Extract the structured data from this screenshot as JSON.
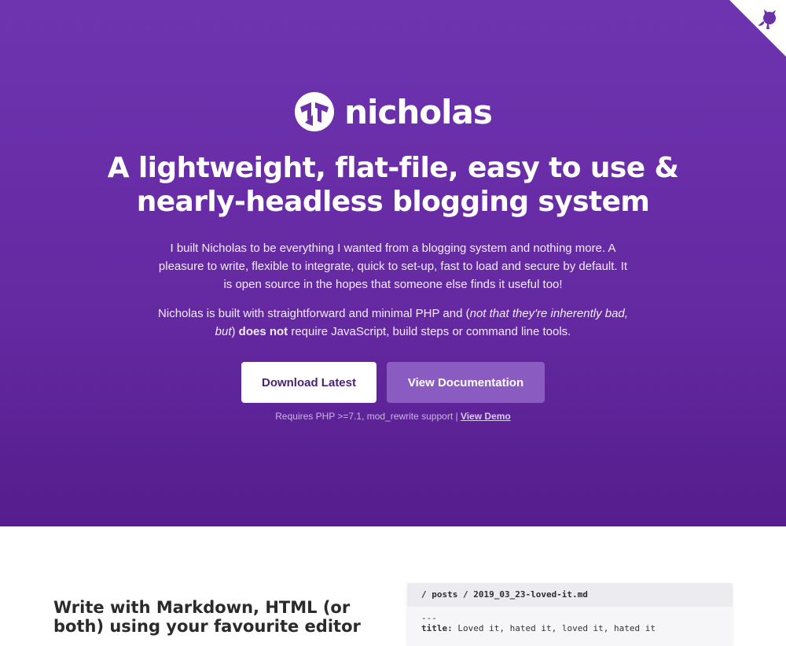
{
  "brand": {
    "name": "nicholas"
  },
  "hero": {
    "headline": "A lightweight, flat-file, easy to use & nearly-headless blogging system",
    "intro": "I built Nicholas to be everything I wanted from a blogging system and nothing more. A pleasure to write, flexible to integrate, quick to set-up, fast to load and secure by default. It is open source in the hopes that someone else finds it useful too!",
    "builtwith": {
      "lead": "Nicholas is built with straightforward and minimal PHP and (",
      "emph": "not that they're inherently bad, but",
      "close": ") ",
      "strong": "does not",
      "tail": " require JavaScript, build steps or command line tools."
    },
    "download_label": "Download Latest",
    "docs_label": "View Documentation",
    "requirements": "Requires PHP >=7.1, mod_rewrite support | ",
    "demo_link": "View Demo"
  },
  "corner": {
    "icon": "github-octocat-icon"
  },
  "feature": {
    "title": "Write with Markdown, HTML (or both) using your favourite editor",
    "code_path": "/ posts / 2019_03_23-loved-it.md",
    "code_line1": "---",
    "code_key": "title:",
    "code_value": " Loved it, hated it, loved it, hated it"
  },
  "colors": {
    "hero_bg": "#6b31a8",
    "docs_button": "#8a5cc2",
    "download_text": "#4a2378"
  }
}
